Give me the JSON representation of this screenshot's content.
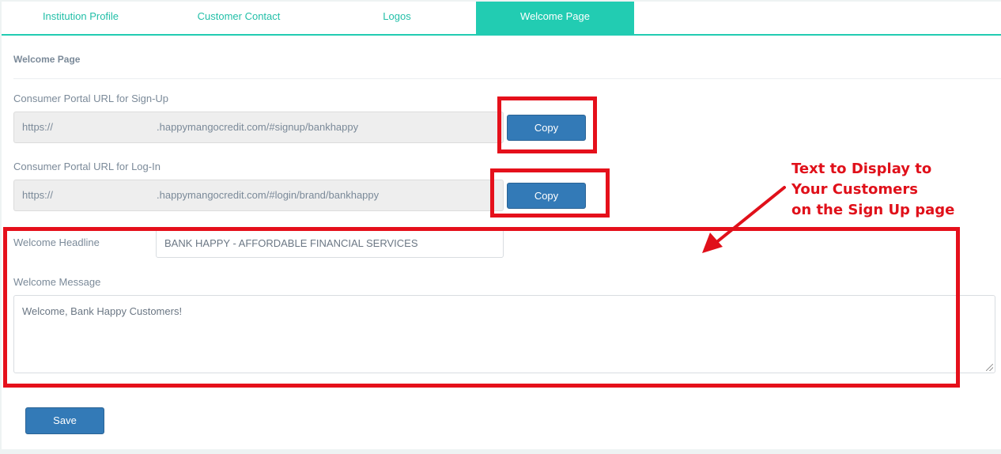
{
  "tabs": [
    {
      "label": "Institution Profile",
      "active": false
    },
    {
      "label": "Customer Contact",
      "active": false
    },
    {
      "label": "Logos",
      "active": false
    },
    {
      "label": "Welcome Page",
      "active": true
    }
  ],
  "section": {
    "title": "Welcome Page"
  },
  "signup": {
    "label": "Consumer Portal URL for Sign-Up",
    "url_prefix": "https://",
    "url_suffix": ".happymangocredit.com/#signup/bankhappy",
    "copy_label": "Copy"
  },
  "login": {
    "label": "Consumer Portal URL for Log-In",
    "url_prefix": "https://",
    "url_suffix": ".happymangocredit.com/#login/brand/bankhappy",
    "copy_label": "Copy"
  },
  "headline": {
    "label": "Welcome Headline",
    "value": "BANK HAPPY - AFFORDABLE FINANCIAL SERVICES"
  },
  "message": {
    "label": "Welcome Message",
    "value": "Welcome, Bank Happy Customers!"
  },
  "save_label": "Save",
  "annotation": {
    "line1": "Text to Display to",
    "line2": "Your Customers",
    "line3": "on the Sign Up page",
    "color": "#e0101a"
  },
  "colors": {
    "accent": "#22ccb2",
    "button": "#337ab7"
  }
}
